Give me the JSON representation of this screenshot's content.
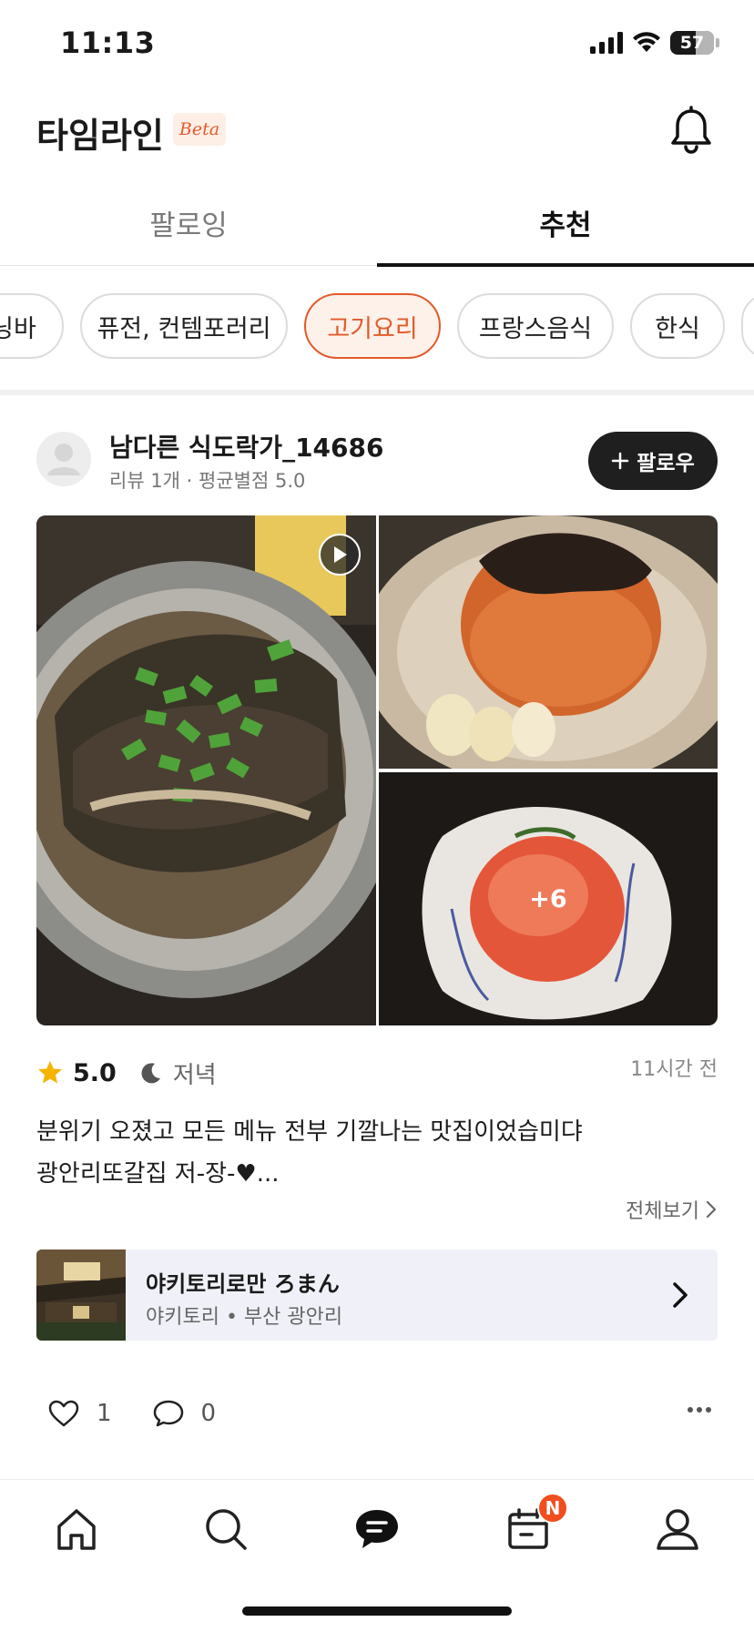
{
  "status_bar": {
    "time": "11:13",
    "battery": "57"
  },
  "header": {
    "title": "타임라인",
    "badge": "Beta"
  },
  "tabs": [
    {
      "label": "팔로잉",
      "active": false
    },
    {
      "label": "추천",
      "active": true
    }
  ],
  "categories": [
    {
      "label": "닝바",
      "active": false
    },
    {
      "label": "퓨전, 컨템포러리",
      "active": false
    },
    {
      "label": "고기요리",
      "active": true
    },
    {
      "label": "프랑스음식",
      "active": false
    },
    {
      "label": "한식",
      "active": false
    }
  ],
  "post": {
    "username": "남다른 식도락가_14686",
    "user_meta": "리뷰 1개 · 평균별점 5.0",
    "follow_label": "팔로우",
    "more_photos": "+6",
    "rating": "5.0",
    "meal": "저녁",
    "time_ago": "11시간 전",
    "review_line1": "분위기 오졌고 모든 메뉴 전부 기깔나는 맛집이었습미댜",
    "review_line2": "광안리또갈집 저-장-♥...",
    "see_all": "전체보기",
    "place": {
      "name": "야키토리로만 ろまん",
      "meta": "야키토리 • 부산 광안리"
    },
    "likes": "1",
    "comments": "0"
  },
  "nav": {
    "items": [
      "home-icon",
      "search-icon",
      "feed-icon",
      "calendar-icon",
      "profile-icon"
    ],
    "badge": "N"
  },
  "colors": {
    "accent": "#e35a2a",
    "badge": "#f04e1f",
    "dark": "#1f1f1f"
  }
}
